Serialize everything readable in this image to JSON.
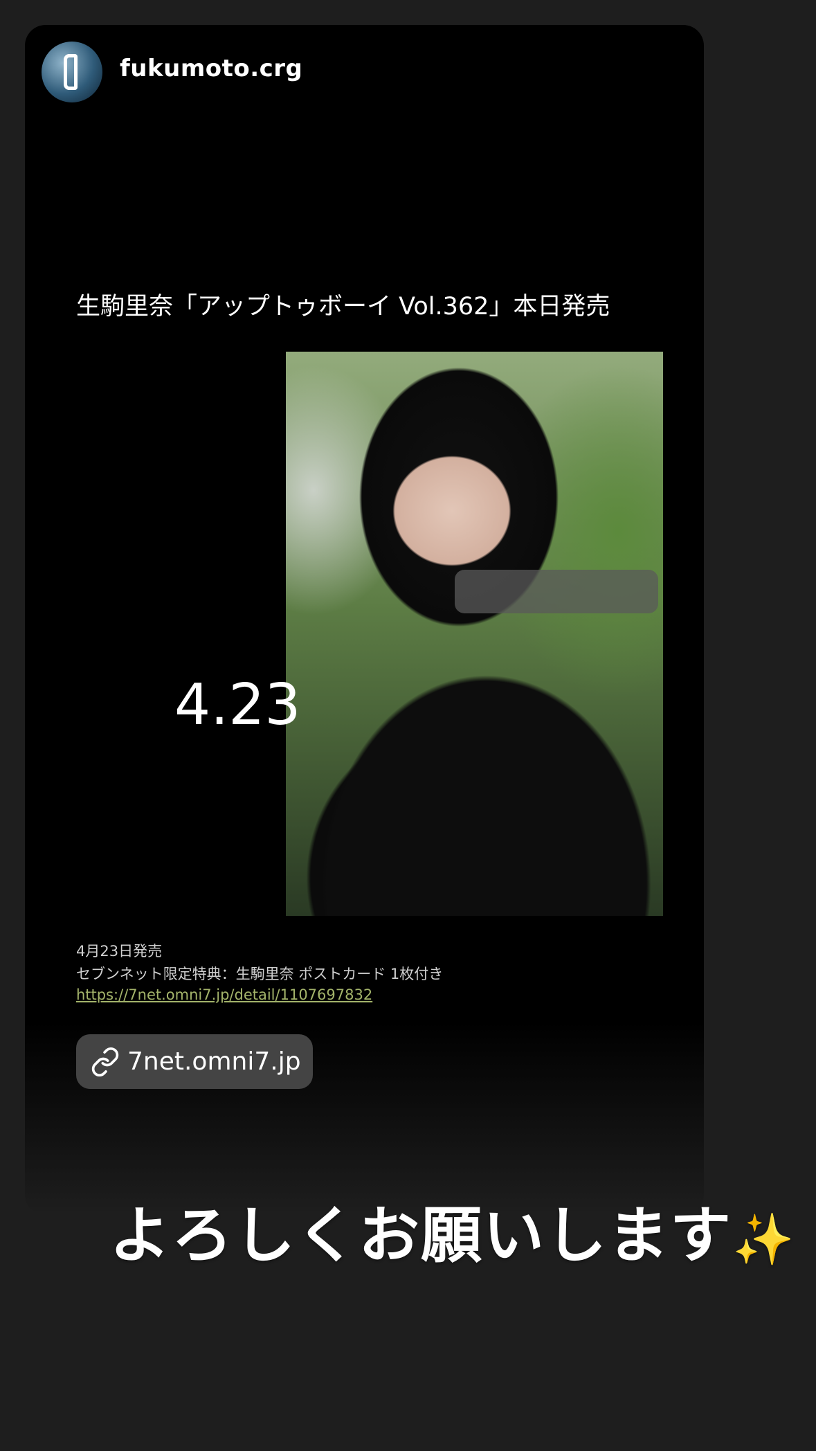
{
  "story": {
    "username": "fukumoto.crg"
  },
  "post": {
    "title": "生駒里奈「アップトゥボーイ Vol.362」本日発売",
    "big_date": "4.23",
    "release_text": "4月23日発売",
    "bonus_text": "セブンネット限定特典：生駒里奈 ポストカード 1枚付き",
    "url": "https://7net.omni7.jp/detail/1107697832"
  },
  "link_sticker": {
    "icon": "link-icon",
    "domain": "7net.omni7.jp"
  },
  "caption": {
    "text": "よろしくお願いします",
    "emoji": "✨"
  }
}
